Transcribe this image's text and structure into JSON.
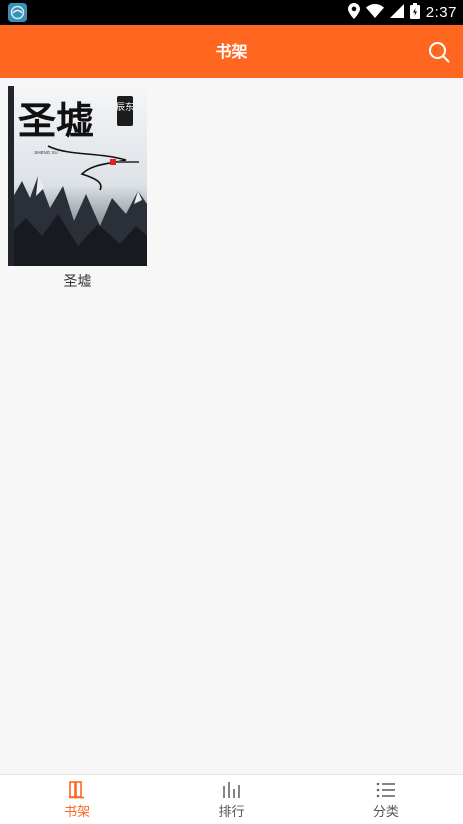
{
  "status_bar": {
    "time": "2:37",
    "icons": [
      "location-icon",
      "wifi-icon",
      "signal-icon",
      "battery-icon"
    ]
  },
  "app_bar": {
    "title": "书架",
    "search_icon": "search-icon"
  },
  "shelf": {
    "books": [
      {
        "title": "圣墟",
        "cover_text": {
          "title": "圣墟",
          "author": "辰东",
          "pinyin": "SHENG XU"
        }
      }
    ]
  },
  "bottom_nav": {
    "items": [
      {
        "label": "书架",
        "icon": "bookshelf-icon",
        "active": true
      },
      {
        "label": "排行",
        "icon": "ranking-bars-icon",
        "active": false
      },
      {
        "label": "分类",
        "icon": "category-list-icon",
        "active": false
      }
    ]
  },
  "colors": {
    "accent": "#ff6720",
    "background": "#f7f7f7",
    "nav_inactive": "#555555"
  }
}
